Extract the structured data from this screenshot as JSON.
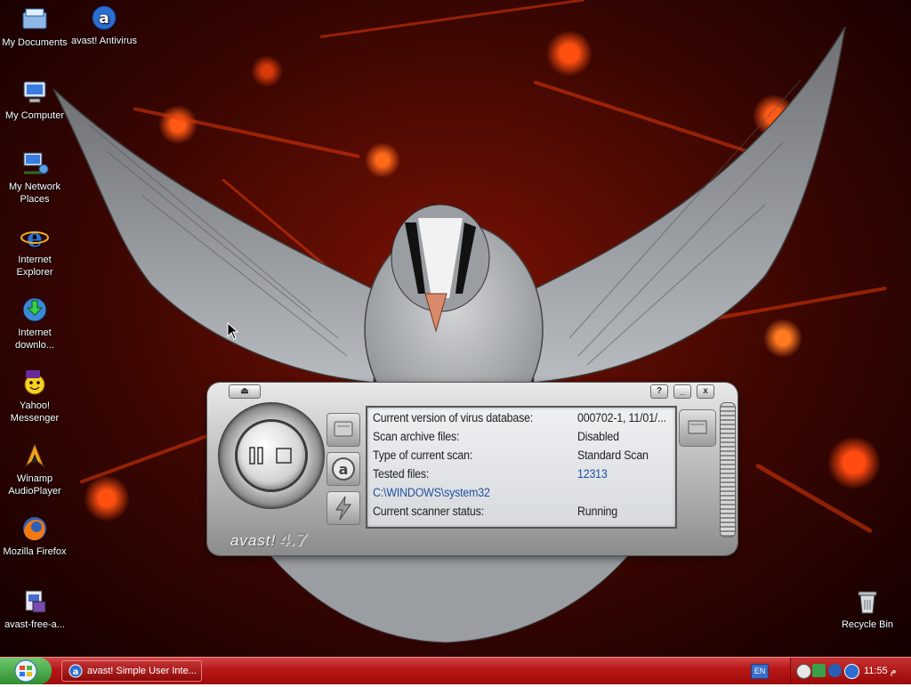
{
  "desktop_icons": [
    {
      "label": "My Documents",
      "icon": "my-documents-icon"
    },
    {
      "label": "avast! Antivirus",
      "icon": "avast-icon"
    },
    {
      "label": "My Computer",
      "icon": "my-computer-icon"
    },
    {
      "label": "My Network Places",
      "icon": "network-places-icon"
    },
    {
      "label": "Internet Explorer",
      "icon": "internet-explorer-icon"
    },
    {
      "label": "Internet downlo...",
      "icon": "internet-download-manager-icon"
    },
    {
      "label": "Yahoo! Messenger",
      "icon": "yahoo-messenger-icon"
    },
    {
      "label": "Winamp AudioPlayer",
      "icon": "winamp-icon"
    },
    {
      "label": "Mozilla Firefox",
      "icon": "firefox-icon"
    },
    {
      "label": "avast-free-a...",
      "icon": "installer-icon"
    },
    {
      "label": "Recycle Bin",
      "icon": "recycle-bin-icon"
    }
  ],
  "avast": {
    "logo_text": "avast!",
    "version": "4.7",
    "help_label": "?",
    "minimize_label": "_",
    "close_label": "x",
    "eject_label": "⏏",
    "rows": [
      {
        "label": "Current version of virus database:",
        "value": "000702-1, 11/01/..."
      },
      {
        "label": "Scan archive files:",
        "value": "Disabled"
      },
      {
        "label": "Type of current scan:",
        "value": "Standard Scan"
      },
      {
        "label": "Tested files:",
        "value": "12313"
      },
      {
        "label": "C:\\WINDOWS\\system32",
        "value": ""
      },
      {
        "label": "Current scanner status:",
        "value": "Running"
      }
    ]
  },
  "taskbar": {
    "task_label": "avast! Simple User Inte...",
    "language": "EN",
    "clock": "11:55 م"
  },
  "colors": {
    "taskbar": "#b81818",
    "highlight_value": "#2050a0"
  }
}
